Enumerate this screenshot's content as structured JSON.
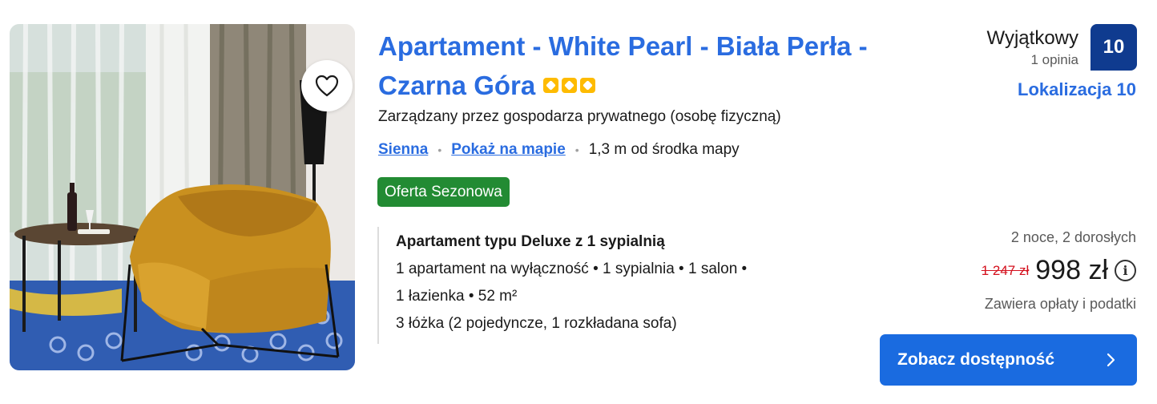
{
  "property": {
    "title": "Apartament - White Pearl - Biała Perła - Czarna Góra",
    "stars": 3,
    "managed_by": "Zarządzany przez gospodarza prywatnego (osobę fizyczną)",
    "location_link": "Sienna",
    "map_link": "Pokaż na mapie",
    "distance": "1,3 m od środka mapy",
    "badge": "Oferta Sezonowa"
  },
  "rating": {
    "word": "Wyjątkowy",
    "count": "1 opinia",
    "score": "10",
    "location_score": "Lokalizacja 10"
  },
  "room": {
    "name": "Apartament typu Deluxe z 1 sypialnią",
    "line1": "1 apartament na wyłączność • 1 sypialnia • 1 salon •",
    "line2": "1 łazienka • 52 m²",
    "line3": "3 łóżka (2 pojedyncze, 1 rozkładana sofa)"
  },
  "price": {
    "stay": "2 noce, 2 dorosłych",
    "old": "1 247 zł",
    "new": "998 zł",
    "taxes": "Zawiera opłaty i podatki",
    "info_icon": "info-icon"
  },
  "cta": {
    "label": "Zobacz dostępność",
    "icon": "chevron-right-icon"
  },
  "icons": {
    "favorite": "heart-icon"
  },
  "colors": {
    "link": "#2a6ce0",
    "score_bg": "#0f3b8f",
    "badge_bg": "#228b33",
    "star": "#febb02",
    "old_price": "#d4111e",
    "cta_bg": "#1a6be0"
  }
}
